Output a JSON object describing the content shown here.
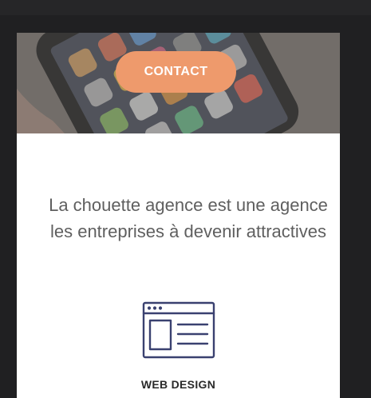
{
  "hero": {
    "contact_label": "CONTACT"
  },
  "intro": {
    "line1": "La chouette agence est une agence",
    "line2": "les entreprises à devenir attractives"
  },
  "services": [
    {
      "icon": "web-browser-layout-icon",
      "title": "WEB DESIGN"
    }
  ],
  "colors": {
    "accent": "#ee9a6c",
    "text": "#5f5f5f",
    "icon": "#3a4170",
    "background": "#202022"
  }
}
